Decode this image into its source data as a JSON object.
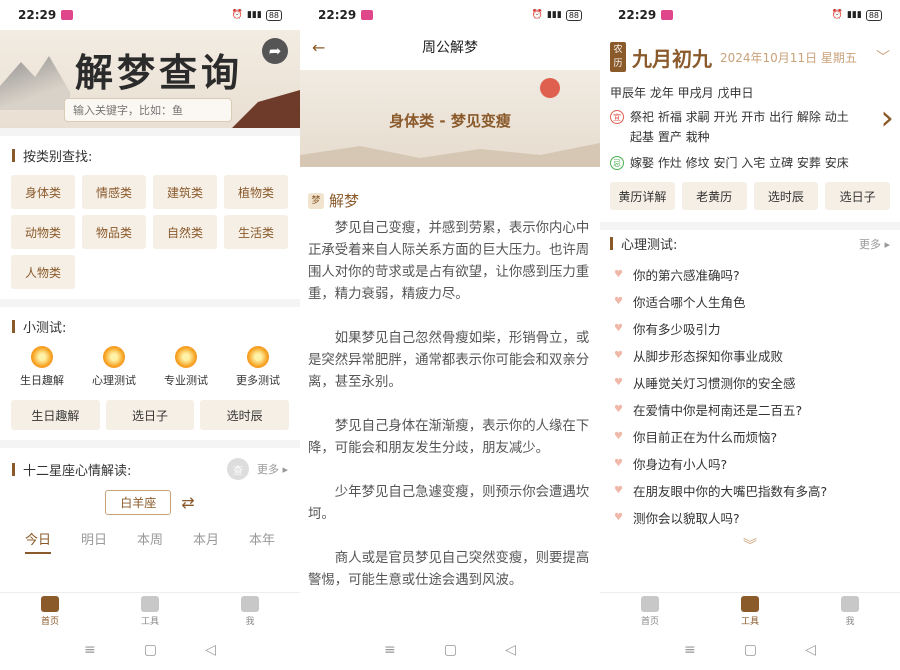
{
  "status": {
    "time": "22:29",
    "battery": "88"
  },
  "tabs": [
    "首页",
    "工具",
    "我"
  ],
  "nav_icons": [
    "≡",
    "▢",
    "◁"
  ],
  "p1": {
    "title": "解梦查询",
    "search_placeholder": "输入关键字，比如：鱼",
    "category_header": "按类别查找:",
    "categories": [
      "身体类",
      "情感类",
      "建筑类",
      "植物类",
      "动物类",
      "物品类",
      "自然类",
      "生活类",
      "人物类"
    ],
    "tests_header": "小测试:",
    "tests": [
      "生日趣解",
      "心理测试",
      "专业测试",
      "更多测试"
    ],
    "buttons": [
      "生日趣解",
      "选日子",
      "选时辰"
    ],
    "zodiac_header": "十二星座心情解读:",
    "zodiac_badge": "查",
    "more": "更多 ▸",
    "zodiac_select": "白羊座",
    "periods": [
      "今日",
      "明日",
      "本周",
      "本月",
      "本年"
    ]
  },
  "p2": {
    "title": "周公解梦",
    "banner": "身体类 - 梦见变瘦",
    "section_badge": "梦",
    "section": "解梦",
    "paragraphs": [
      "梦见自己变瘦，并感到劳累，表示你内心中正承受着来自人际关系方面的巨大压力。也许周围人对你的苛求或是占有欲望，让你感到压力重重，精力衰弱，精疲力尽。",
      "如果梦见自己忽然骨瘦如柴，形销骨立，或是突然异常肥胖，通常都表示你可能会和双亲分离，甚至永别。",
      "梦见自己身体在渐渐瘦，表示你的人缘在下降，可能会和朋友发生分歧，朋友减少。",
      "少年梦见自己急遽变瘦，则预示你会遭遇坎坷。",
      "商人或是官员梦见自己突然变瘦，则要提高警惕，可能生意或仕途会遇到风波。"
    ]
  },
  "p3": {
    "badge": "农历",
    "lunar": "九月初九",
    "greg": "2024年10月11日 星期五",
    "ganzhi": "甲辰年 龙年 甲戌月 戊申日",
    "yi_mark": "宜",
    "yi": "祭祀 祈福 求嗣 开光 开市 出行 解除 动土 起基 置产 栽种",
    "ji_mark": "忌",
    "ji": "嫁娶 作灶 修坟 安门 入宅 立碑 安葬 安床",
    "buttons": [
      "黄历详解",
      "老黄历",
      "选时辰",
      "选日子"
    ],
    "psy_header": "心理测试:",
    "more": "更多 ▸",
    "items": [
      "你的第六感准确吗?",
      "你适合哪个人生角色",
      "你有多少吸引力",
      "从脚步形态探知你事业成败",
      "从睡觉关灯习惯测你的安全感",
      "在爱情中你是柯南还是二百五?",
      "你目前正在为什么而烦恼?",
      "你身边有小人吗?",
      "在朋友眼中你的大嘴巴指数有多高?",
      "测你会以貌取人吗?"
    ]
  }
}
